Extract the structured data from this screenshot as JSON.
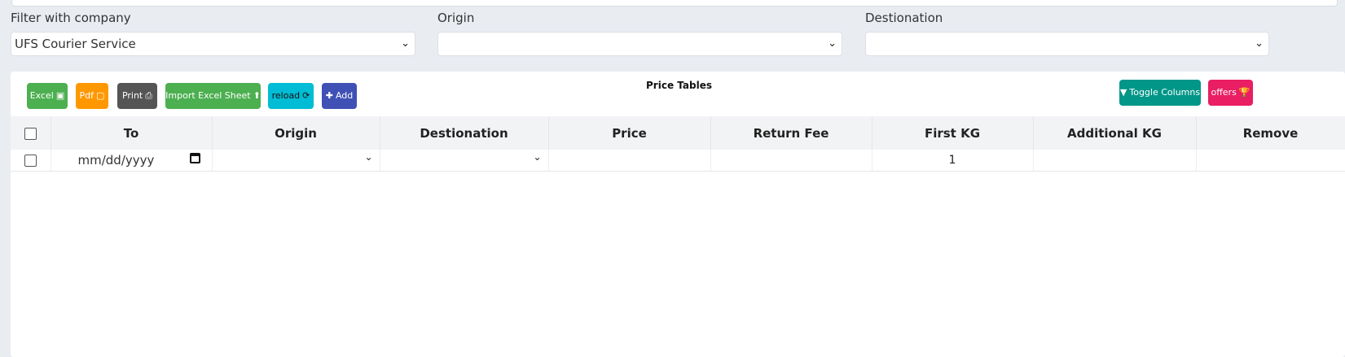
{
  "filters": {
    "company": {
      "label": "Filter with company",
      "value": "UFS Courier Service"
    },
    "origin": {
      "label": "Origin",
      "value": ""
    },
    "destination": {
      "label": "Destionation",
      "value": ""
    }
  },
  "toolbar": {
    "excel": "Excel",
    "pdf": "Pdf",
    "print": "Print",
    "import": "Import Excel Sheet",
    "reload": "reload",
    "add": "Add",
    "toggle_columns": "Toggle Columns",
    "offers": "offers"
  },
  "table": {
    "title": "Price Tables",
    "columns": [
      "To",
      "Origin",
      "Destionation",
      "Price",
      "Return Fee",
      "First KG",
      "Additional KG",
      "Remove"
    ],
    "row": {
      "date_placeholder": "mm/dd/yyyy",
      "first_kg": "1"
    }
  },
  "colors": {
    "excel": "#4caf50",
    "pdf": "#ff9800",
    "print": "#555555",
    "import": "#4caf50",
    "reload": "#00bcd4",
    "add": "#3f51b5",
    "toggle": "#009688",
    "offers": "#e91e63"
  }
}
